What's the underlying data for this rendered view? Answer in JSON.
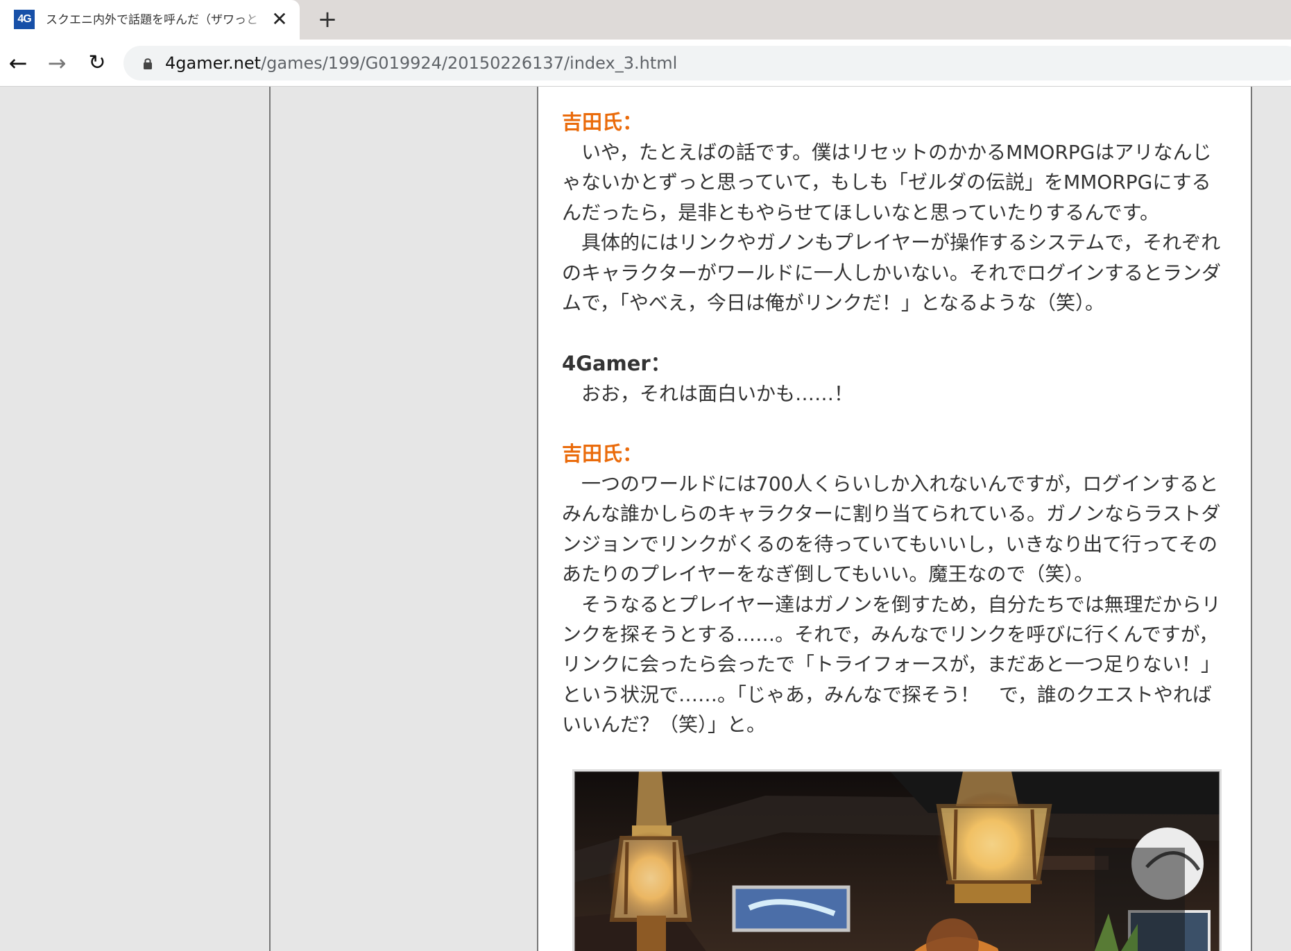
{
  "browser": {
    "tab": {
      "favicon_text": "4G",
      "title": "スクエニ内外で話題を呼んだ（ザワっと",
      "close_icon": "close-icon"
    },
    "new_tab_icon": "plus-icon",
    "navigation": {
      "back_icon": "arrow-left-icon",
      "forward_icon": "arrow-right-icon",
      "reload_icon": "reload-icon"
    },
    "address": {
      "lock_icon": "lock-icon",
      "host": "4gamer.net",
      "path": "/games/199/G019924/20150226137/index_3.html"
    }
  },
  "article": {
    "blocks": [
      {
        "speaker": "吉田氏：",
        "speaker_color": "#ea6b0b",
        "paragraphs": [
          "いや，たとえばの話です。僕はリセットのかかるMMORPGはアリなんじゃないかとずっと思っていて，もしも「ゼルダの伝説」をMMORPGにするんだったら，是非ともやらせてほしいなと思っていたりするんです。",
          "具体的にはリンクやガノンもプレイヤーが操作するシステムで，それぞれのキャラクターがワールドに一人しかいない。それでログインするとランダムで，「やべえ，今日は俺がリンクだ！」となるような（笑）。"
        ]
      },
      {
        "speaker": "4Gamer：",
        "speaker_color": "#333333",
        "paragraphs": [
          "おお，それは面白いかも……！"
        ]
      },
      {
        "speaker": "吉田氏：",
        "speaker_color": "#ea6b0b",
        "paragraphs": [
          "一つのワールドには700人くらいしか入れないんですが，ログインするとみんな誰かしらのキャラクターに割り当てられている。ガノンならラストダンジョンでリンクがくるのを待っていてもいいし，いきなり出て行ってそのあたりのプレイヤーをなぎ倒してもいい。魔王なので（笑）。",
          "そうなるとプレイヤー達はガノンを倒すため，自分たちでは無理だからリンクを探そうとする……。それで，みんなでリンクを呼びに行くんですが，リンクに会ったら会ったで「トライフォースが，まだあと一つ足りない！」という状況で……。「じゃあ，みんなで探そう！　で，誰のクエストやればいいんだ？（笑）」と。"
        ]
      }
    ],
    "photo_icon": "event-photo-image"
  }
}
